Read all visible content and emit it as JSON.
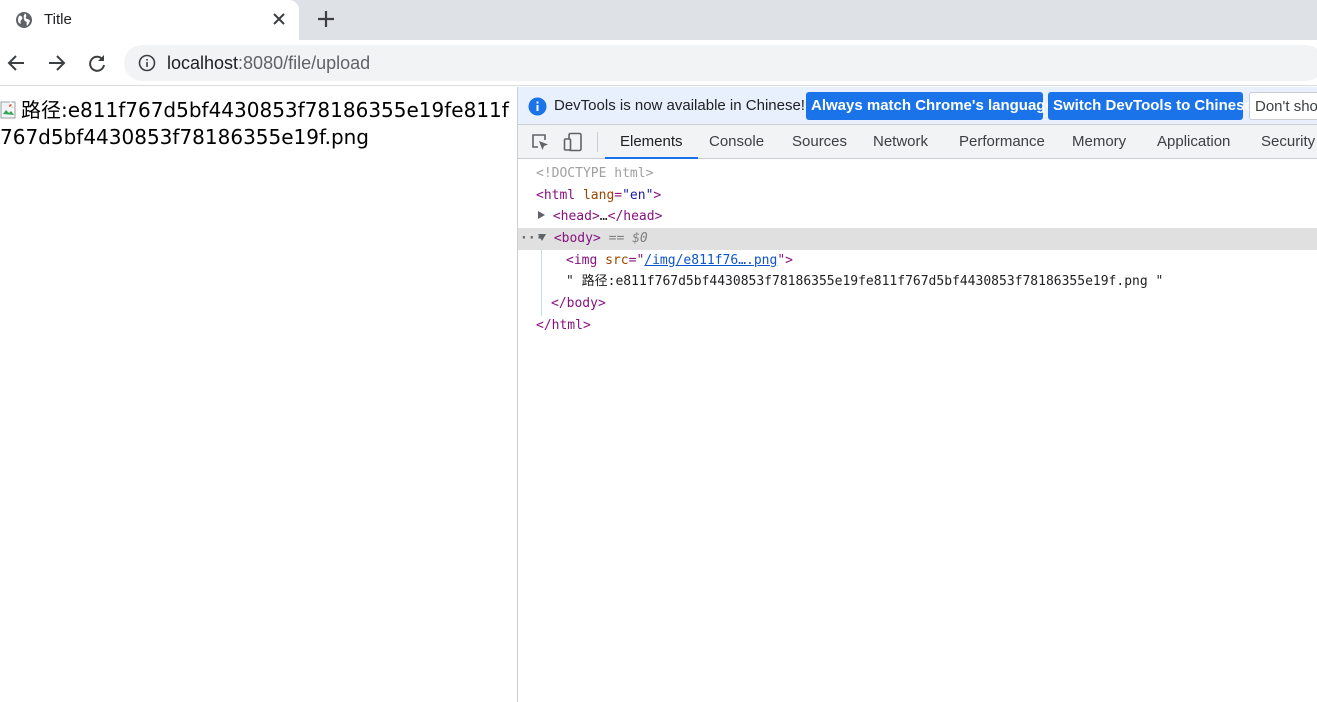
{
  "browser": {
    "tab_title": "Title",
    "url_host": "localhost",
    "url_path": ":8080/file/upload"
  },
  "page": {
    "text": "路径:e811f767d5bf4430853f78186355e19fe811f767d5bf4430853f78186355e19f.png"
  },
  "devtools": {
    "infobar": {
      "message": "DevTools is now available in Chinese!",
      "btn_match": "Always match Chrome's language",
      "btn_switch": "Switch DevTools to Chinese",
      "btn_dont_show": "Don't show again"
    },
    "tabs": [
      "Elements",
      "Console",
      "Sources",
      "Network",
      "Performance",
      "Memory",
      "Application",
      "Security"
    ],
    "active_tab": "Elements",
    "dom": {
      "doctype": "<!DOCTYPE html>",
      "html_open_tag": "html",
      "html_attr": "lang",
      "html_attr_value": "\"en\"",
      "head_tag": "head",
      "head_ellipsis": "…",
      "body_tag": "body",
      "body_selected_marker": "== $0",
      "img_tag": "img",
      "img_attr": "src",
      "img_src": "/img/e811f76….png",
      "text_node": "\" 路径:e811f767d5bf4430853f78186355e19fe811f767d5bf4430853f78186355e19f.png \"",
      "body_close": "body",
      "html_close": "html"
    }
  }
}
